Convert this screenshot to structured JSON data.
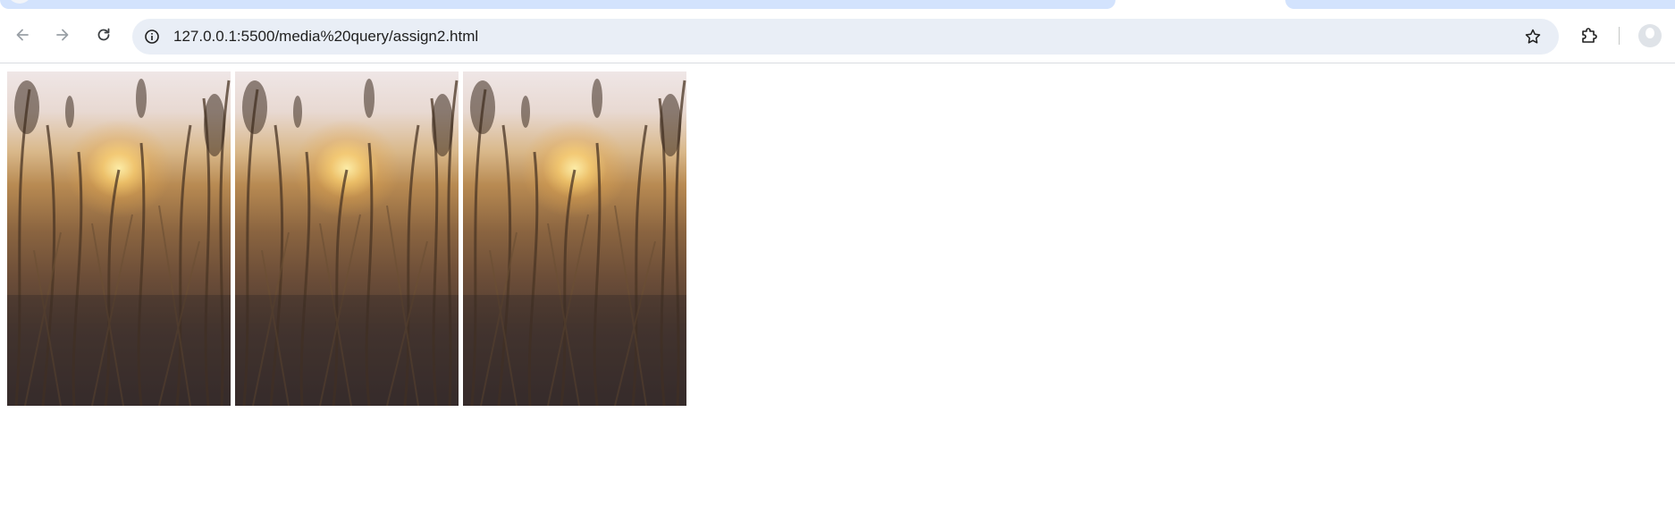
{
  "browser": {
    "url": "127.0.0.1:5500/media%20query/assign2.html"
  },
  "toolbar": {
    "back_icon": "arrow-left-icon",
    "forward_icon": "arrow-right-icon",
    "reload_icon": "reload-icon",
    "info_icon": "info-icon",
    "bookmark_icon": "star-icon",
    "extensions_icon": "puzzle-icon",
    "profile_icon": "avatar-icon"
  },
  "gallery": {
    "images": [
      {
        "alt": "grass-at-sunset"
      },
      {
        "alt": "grass-at-sunset"
      },
      {
        "alt": "grass-at-sunset"
      }
    ]
  },
  "colors": {
    "tab_active": "#d3e3fd",
    "omnibox": "#e9eef6",
    "toolbar_icon": "#5f6368"
  }
}
